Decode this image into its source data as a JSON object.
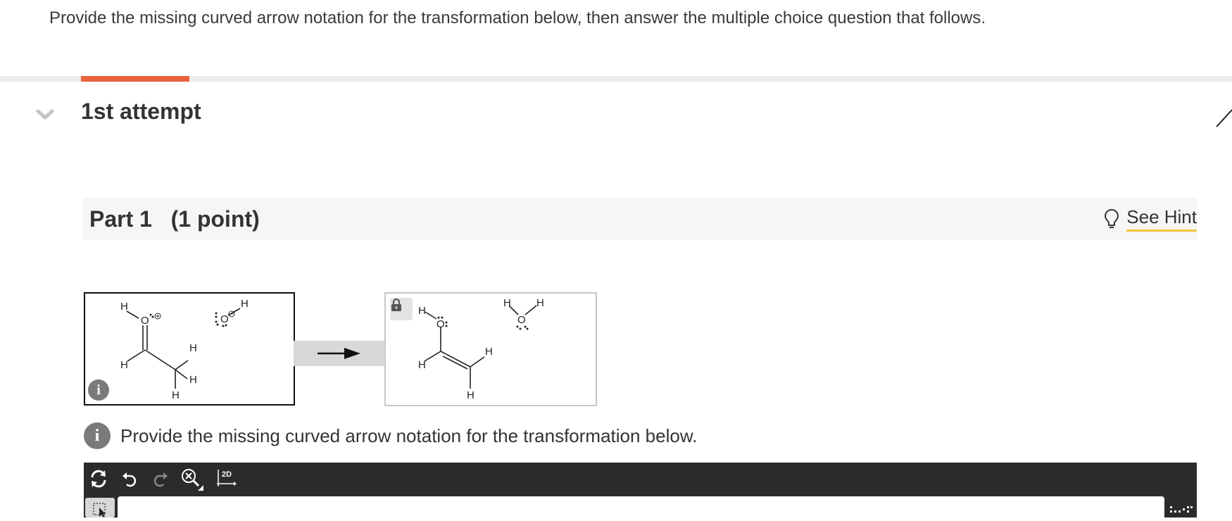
{
  "question": {
    "intro": "Provide the missing curved arrow notation for the transformation below, then answer the multiple choice question that follows."
  },
  "attempt": {
    "title": "1st attempt",
    "progress_fraction": 0.088
  },
  "part": {
    "title": "Part 1",
    "points": "(1 point)",
    "hint_label": "See Hint"
  },
  "reaction": {
    "start_labels": {
      "h": "H",
      "o": "O"
    },
    "end_labels": {
      "h": "H",
      "o": "O"
    }
  },
  "instruction": {
    "text": "Provide the missing curved arrow notation for the transformation below."
  },
  "toolbar": {
    "two_d_label": "2D"
  },
  "colors": {
    "accent": "#e8603c",
    "hint_underline": "#f3c23e",
    "toolbar_bg": "#2b2b2b"
  }
}
